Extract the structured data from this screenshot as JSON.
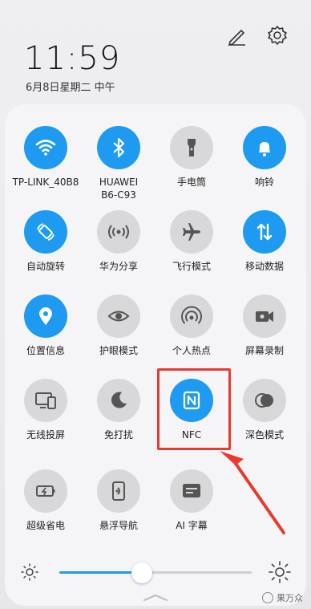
{
  "status": {
    "time": "11:59",
    "date": "6月8日星期二 中午"
  },
  "tiles": [
    {
      "label": "TP-LINK_40B8",
      "icon": "wifi-icon",
      "state": "on"
    },
    {
      "label": "HUAWEI\nB6-C93",
      "icon": "bluetooth-icon",
      "state": "on"
    },
    {
      "label": "手电筒",
      "icon": "flashlight-icon",
      "state": "off"
    },
    {
      "label": "响铃",
      "icon": "bell-icon",
      "state": "on"
    },
    {
      "label": "自动旋转",
      "icon": "auto-rotate-icon",
      "state": "on"
    },
    {
      "label": "华为分享",
      "icon": "huawei-share-icon",
      "state": "off"
    },
    {
      "label": "飞行模式",
      "icon": "airplane-icon",
      "state": "off"
    },
    {
      "label": "移动数据",
      "icon": "mobile-data-icon",
      "state": "on"
    },
    {
      "label": "位置信息",
      "icon": "location-icon",
      "state": "on"
    },
    {
      "label": "护眼模式",
      "icon": "eye-icon",
      "state": "off"
    },
    {
      "label": "个人热点",
      "icon": "hotspot-icon",
      "state": "off"
    },
    {
      "label": "屏幕录制",
      "icon": "screen-record-icon",
      "state": "off"
    },
    {
      "label": "无线投屏",
      "icon": "wireless-projection-icon",
      "state": "off"
    },
    {
      "label": "免打扰",
      "icon": "do-not-disturb-icon",
      "state": "off"
    },
    {
      "label": "NFC",
      "icon": "nfc-icon",
      "state": "on"
    },
    {
      "label": "深色模式",
      "icon": "dark-mode-icon",
      "state": "off"
    },
    {
      "label": "超级省电",
      "icon": "power-saving-icon",
      "state": "off"
    },
    {
      "label": "悬浮导航",
      "icon": "floating-nav-icon",
      "state": "off"
    },
    {
      "label": "AI 字幕",
      "icon": "ai-subtitle-icon",
      "state": "off"
    }
  ],
  "brightness": {
    "level": 0.43
  },
  "watermark": {
    "text": "果万众"
  },
  "colors": {
    "accent": "#1e9bf0",
    "tile_off": "#d8d8da",
    "highlight": "#e83a2f"
  }
}
